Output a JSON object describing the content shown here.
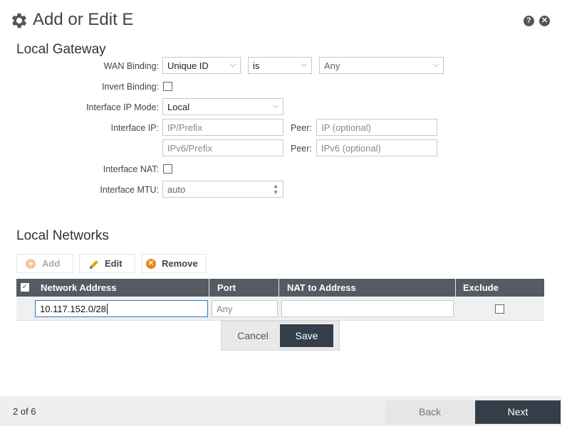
{
  "header": {
    "title": "Add or Edit E"
  },
  "local_gateway": {
    "heading": "Local Gateway",
    "wan_binding": {
      "label": "WAN Binding:",
      "type_value": "Unique ID",
      "operator_value": "is",
      "target_value": "Any"
    },
    "invert_binding": {
      "label": "Invert Binding:"
    },
    "interface_ip_mode": {
      "label": "Interface IP Mode:",
      "value": "Local"
    },
    "interface_ip": {
      "label": "Interface IP:",
      "ipv4_placeholder": "IP/Prefix",
      "peer_label": "Peer:",
      "peer_placeholder": "IP (optional)",
      "ipv6_placeholder": "IPv6/Prefix",
      "peer6_label": "Peer:",
      "peer6_placeholder": "IPv6 (optional)"
    },
    "interface_nat": {
      "label": "Interface NAT:"
    },
    "interface_mtu": {
      "label": "Interface MTU:",
      "value": "auto"
    }
  },
  "local_networks": {
    "heading": "Local Networks",
    "toolbar": {
      "add": "Add",
      "edit": "Edit",
      "remove": "Remove"
    },
    "columns": [
      "Network Address",
      "Port",
      "NAT to Address",
      "Exclude"
    ],
    "edit_row": {
      "network_address": "10.117.152.0/28",
      "port_placeholder": "Any",
      "nat_to_address": ""
    },
    "row_actions": {
      "cancel": "Cancel",
      "save": "Save"
    }
  },
  "footer": {
    "step": "2 of 6",
    "back": "Back",
    "next": "Next"
  },
  "icons": [
    "gear-icon",
    "help-icon",
    "close-icon",
    "add-icon",
    "pencil-icon",
    "remove-icon",
    "checkbox-icon",
    "spinner-icon"
  ],
  "colors": {
    "header_bg": "#555b61",
    "primary_button": "#343e48",
    "add_icon": "#f0c8a0",
    "edit_icon": "#e8a21c",
    "remove_icon": "#e8861c"
  }
}
